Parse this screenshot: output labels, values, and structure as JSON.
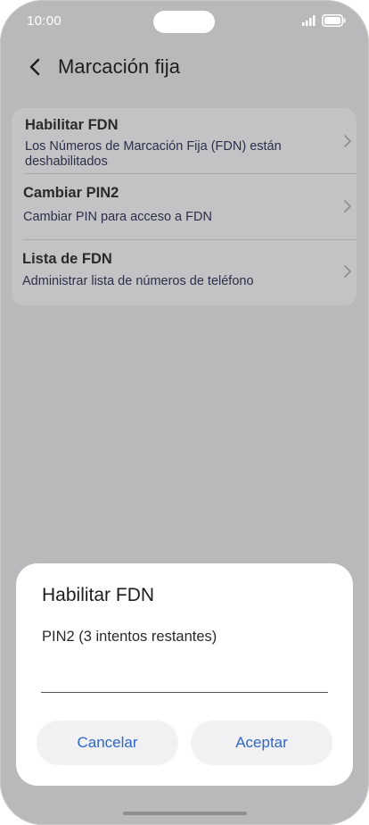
{
  "status_bar": {
    "time": "10:00"
  },
  "header": {
    "title": "Marcación fija"
  },
  "settings": {
    "items": [
      {
        "title": "Habilitar FDN",
        "subtitle": "Los Números de Marcación Fija (FDN) están deshabilitados"
      },
      {
        "title": "Cambiar PIN2",
        "subtitle": "Cambiar PIN para acceso a FDN"
      },
      {
        "title": "Lista de FDN",
        "subtitle": "Administrar lista de números de teléfono"
      }
    ]
  },
  "dialog": {
    "title": "Habilitar FDN",
    "pin_label": "PIN2 (3 intentos restantes)",
    "pin_value": "",
    "cancel_label": "Cancelar",
    "accept_label": "Aceptar"
  },
  "colors": {
    "accent": "#2f66c3",
    "dimmed_background": "#b9b9bc",
    "card": "#c3c3c6",
    "dialog": "#ffffff"
  },
  "icons": [
    "back-icon",
    "chevron-right-icon",
    "signal-icon",
    "battery-icon"
  ]
}
